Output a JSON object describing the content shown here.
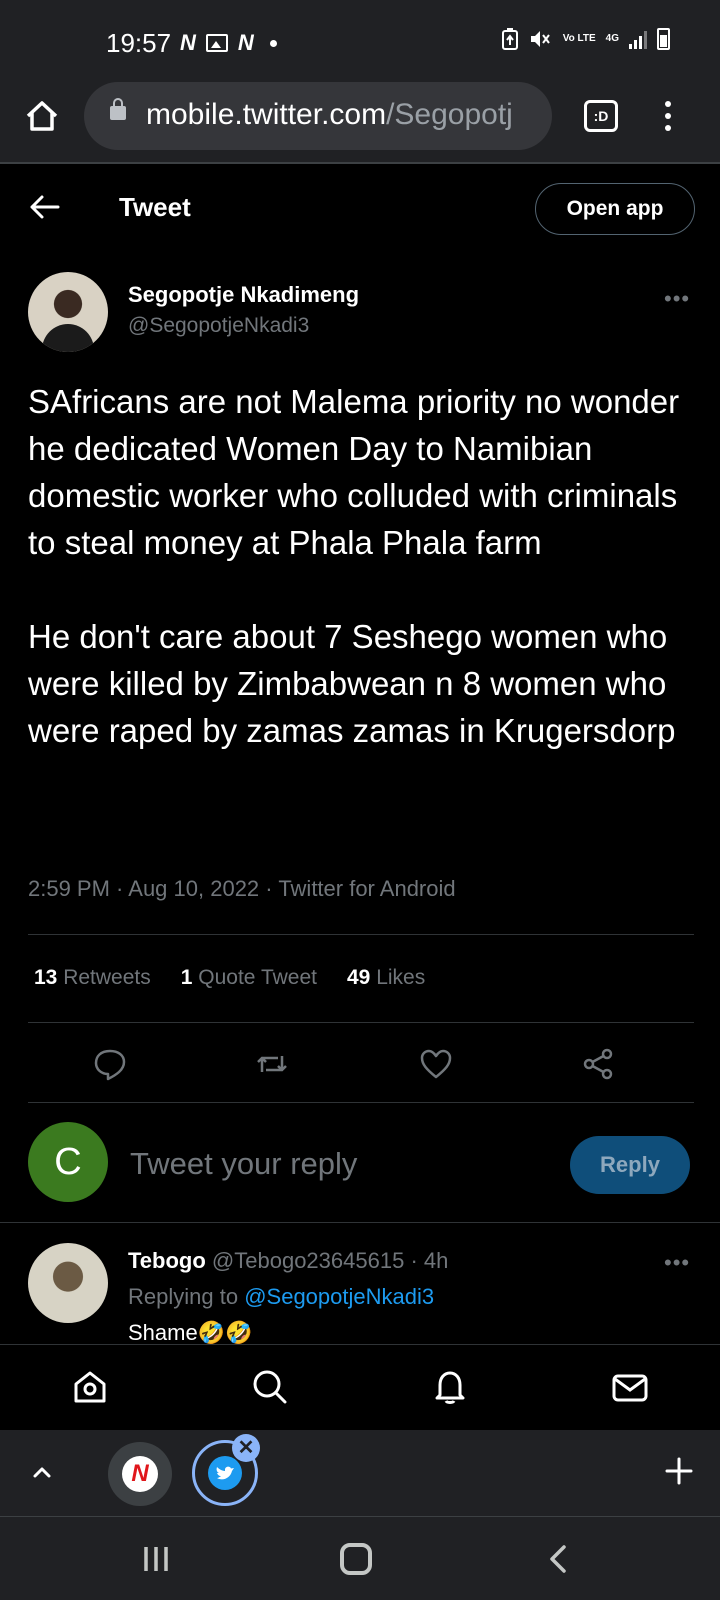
{
  "status_bar": {
    "time": "19:57",
    "left_icons": [
      "n-app-icon",
      "image-icon",
      "n-app-icon",
      "dot-icon"
    ],
    "right_labels": {
      "volte": "Vo LTE",
      "network": "4G"
    }
  },
  "browser": {
    "url_domain": "mobile.twitter.com",
    "url_path": "/Segopotj",
    "tabs_label": ":D"
  },
  "header": {
    "title": "Tweet",
    "open_app_label": "Open app"
  },
  "tweet": {
    "author_name": "Segopotje Nkadimeng",
    "author_handle": "@SegopotjeNkadi3",
    "text": "SAfricans are not Malema priority no wonder he dedicated Women Day to Namibian domestic worker who colluded with criminals to steal money at Phala Phala farm\n\nHe don't care about 7 Seshego women who were killed by Zimbabwean n 8 women who were raped by zamas zamas in Krugersdorp",
    "meta": "2:59 PM · Aug 10, 2022 · Twitter for Android",
    "stats": {
      "retweets_count": "13",
      "retweets_label": "Retweets",
      "quotes_count": "1",
      "quotes_label": "Quote Tweet",
      "likes_count": "49",
      "likes_label": "Likes"
    }
  },
  "composer": {
    "avatar_letter": "C",
    "placeholder": "Tweet your reply",
    "reply_label": "Reply",
    "avatar_color": "#3b7a1f"
  },
  "reply": {
    "author_name": "Tebogo",
    "author_handle": "@Tebogo23645615",
    "time": "· 4h",
    "replying_to_label": "Replying to",
    "replying_to_handle": "@SegopotjeNkadi3",
    "text": "Shame🤣🤣"
  },
  "tab_strip": {
    "n_tab_label": "N",
    "close_label": "✕",
    "plus_label": "+"
  },
  "colors": {
    "accent_blue": "#1d9bf0",
    "background": "#000000",
    "muted_text": "#71767b"
  }
}
